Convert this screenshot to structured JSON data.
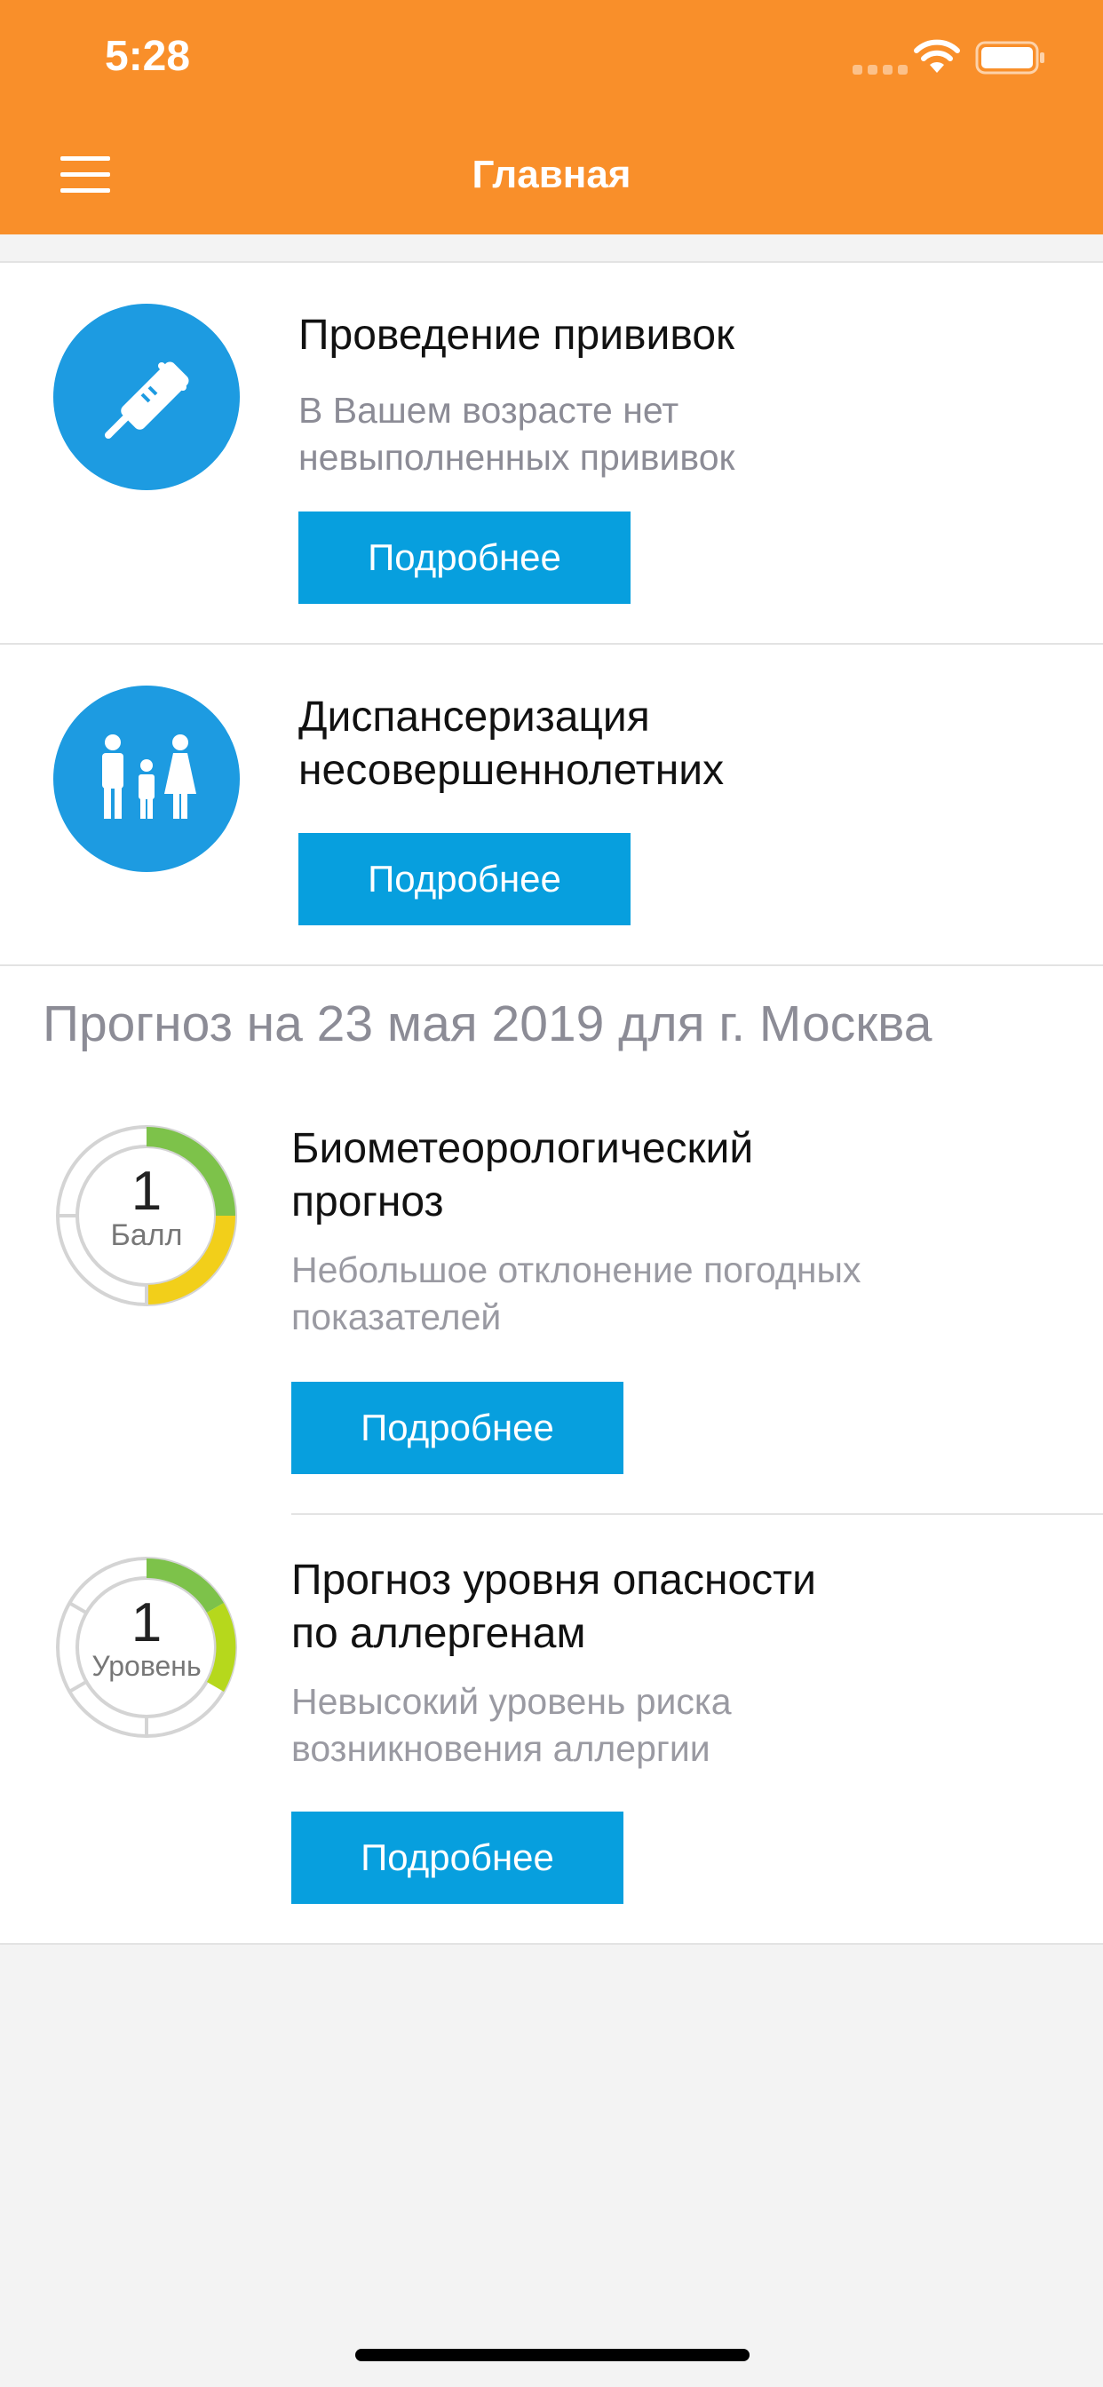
{
  "status_bar": {
    "time": "5:28"
  },
  "header": {
    "title": "Главная",
    "menu_icon": "hamburger-icon"
  },
  "vaccination": {
    "icon": "syringe-icon",
    "title": "Проведение прививок",
    "description_line1": "В Вашем возрасте нет",
    "description_line2": "невыполненных прививок",
    "button": "Подробнее"
  },
  "checkup": {
    "icon": "family-icon",
    "title_line1": "Диспансеризация",
    "title_line2": "несовершеннолетних",
    "button": "Подробнее"
  },
  "forecast": {
    "heading": "Прогноз на 23 мая 2019 для г. Москва",
    "biometeo": {
      "value": "1",
      "unit": "Балл",
      "title_line1": "Биометеорологический",
      "title_line2": "прогноз",
      "description_line1": "Небольшое отклонение погодных",
      "description_line2": "показателей",
      "button": "Подробнее",
      "colors": [
        "#7dc24a",
        "#f2cf1a"
      ]
    },
    "allergen": {
      "value": "1",
      "unit": "Уровень",
      "title_line1": "Прогноз уровня опасности",
      "title_line2": "по аллергенам",
      "description_line1": "Невысокий уровень риска",
      "description_line2": "возникновения аллергии",
      "button": "Подробнее",
      "colors": [
        "#7dc24a",
        "#b6d81c"
      ]
    }
  },
  "colors": {
    "header": "#f98f2a",
    "accent": "#079fde",
    "icon_bg": "#1d9be1"
  }
}
